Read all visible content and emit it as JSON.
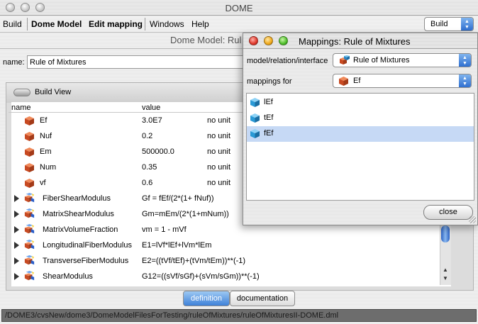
{
  "window": {
    "title": "DOME"
  },
  "menubar": {
    "items": [
      "Build",
      "Dome Model",
      "Edit mapping",
      "Windows",
      "Help"
    ],
    "mode_select": "Build"
  },
  "document": {
    "title": "Dome Model: Rul",
    "name_label": "name:",
    "name_value": "Rule of Mixtures"
  },
  "build_view": {
    "label": "Build View",
    "columns": {
      "name": "name",
      "value": "value"
    },
    "rows": [
      {
        "name": "Ef",
        "value": "3.0E7",
        "unit": "no unit",
        "kind": "parameter"
      },
      {
        "name": "Nuf",
        "value": "0.2",
        "unit": "no unit",
        "kind": "parameter"
      },
      {
        "name": "Em",
        "value": "500000.0",
        "unit": "no unit",
        "kind": "parameter"
      },
      {
        "name": "Num",
        "value": "0.35",
        "unit": "no unit",
        "kind": "parameter"
      },
      {
        "name": "vf",
        "value": "0.6",
        "unit": "no unit",
        "kind": "parameter"
      },
      {
        "name": "FiberShearModulus",
        "value": "Gf = fEf/(2*(1+ fNuf))",
        "unit": "",
        "kind": "relation"
      },
      {
        "name": "MatrixShearModulus",
        "value": "Gm=mEm/(2*(1+mNum))",
        "unit": "",
        "kind": "relation"
      },
      {
        "name": "MatrixVolumeFraction",
        "value": "vm = 1 - mVf",
        "unit": "",
        "kind": "relation"
      },
      {
        "name": "LongitudinalFiberModulus",
        "value": "E1=lVf*lEf+lVm*lEm",
        "unit": "",
        "kind": "relation"
      },
      {
        "name": "TransverseFiberModulus",
        "value": "E2=((tVf/tEf)+(tVm/tEm))**(-1)",
        "unit": "",
        "kind": "relation"
      },
      {
        "name": "ShearModulus",
        "value": "G12=((sVf/sGf)+(sVm/sGm))**(-1)",
        "unit": "",
        "kind": "relation"
      }
    ]
  },
  "tabs": [
    {
      "label": "definition",
      "active": true
    },
    {
      "label": "documentation",
      "active": false
    }
  ],
  "status": {
    "path": "/DOME3/cvsNew/dome3/DomeModelFilesForTesting/ruleOfMixtures/ruleOfMixturesII-DOME.dml"
  },
  "dialog": {
    "title": "Mappings: Rule of Mixtures",
    "interface_label": "model/relation/interface",
    "interface_value": "Rule of Mixtures",
    "mappings_label": "mappings for",
    "mappings_value": "Ef",
    "items": [
      {
        "label": "lEf",
        "selected": false
      },
      {
        "label": "tEf",
        "selected": false
      },
      {
        "label": "fEf",
        "selected": true
      }
    ],
    "close_label": "close"
  },
  "colors": {
    "param_cube": "#d9542b",
    "relation_cube": "#e06a2c",
    "map_cube": "#2a9ad6",
    "selection": "#c6d9f5",
    "accent": "#3f81d8"
  }
}
